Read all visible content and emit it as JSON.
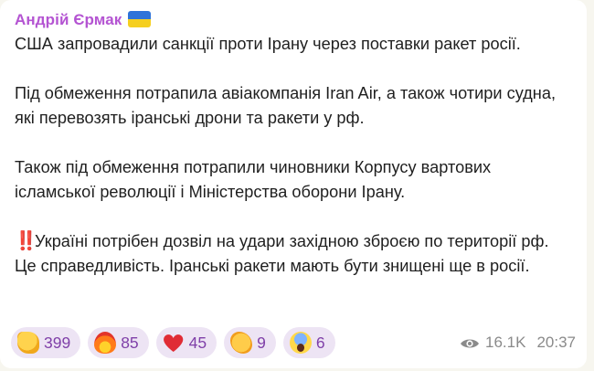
{
  "post": {
    "author": "Андрій Єрмак",
    "author_badge_icon": "ukraine-flag-icon",
    "paragraphs": [
      "США запровадили санкції проти Ірану через поставки ракет росії.",
      "Під обмеження потрапила авіакомпанія Iran Air, а також чотири судна, які перевозять іранські дрони та ракети у рф.",
      "Також під обмеження потрапили чиновники Корпусу вартових ісламської революції і Міністерства оборони Ірану.",
      "Україні потрібен дозвіл на удари західною зброєю по території рф. Це справедливість. Іранські ракети мають бути знищені ще в росії."
    ],
    "warning_icon": "‼️"
  },
  "reactions": [
    {
      "icon": "thumbs-up-icon",
      "count": "399"
    },
    {
      "icon": "fire-icon",
      "count": "85"
    },
    {
      "icon": "heart-icon",
      "count": "45"
    },
    {
      "icon": "handshake-icon",
      "count": "9"
    },
    {
      "icon": "screaming-face-icon",
      "count": "6"
    }
  ],
  "meta": {
    "views": "16.1K",
    "time": "20:37"
  },
  "colors": {
    "author": "#b454d2",
    "reaction_bg": "#ede4f4",
    "reaction_text": "#7f3fa8",
    "meta_text": "#8a8a8a",
    "warning": "#e0352b"
  }
}
